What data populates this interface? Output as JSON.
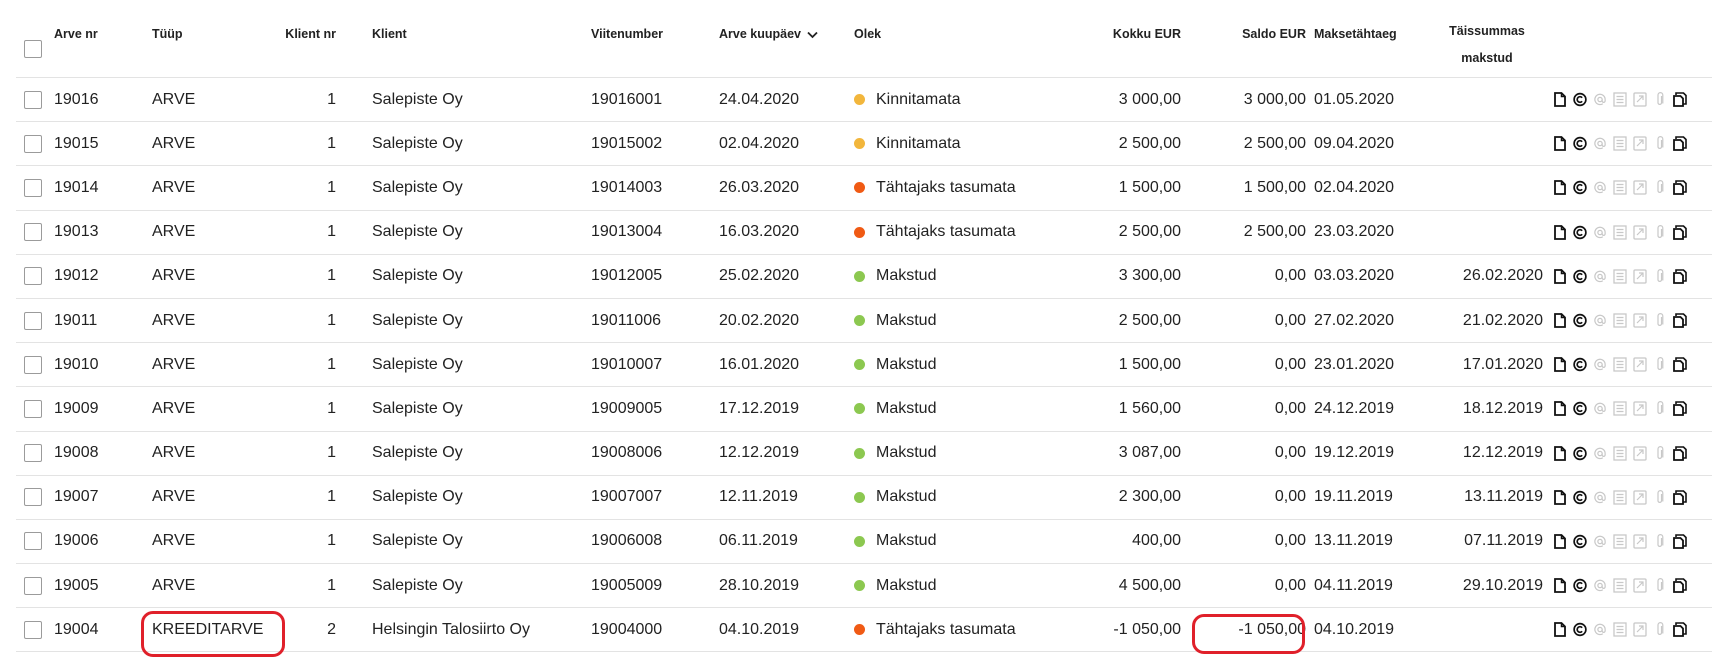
{
  "columns": {
    "arve_nr": "Arve nr",
    "tyyp": "Tüüp",
    "klient_nr": "Klient nr",
    "klient": "Klient",
    "viitenumber": "Viitenumber",
    "arve_kuupaev": "Arve kuupäev",
    "olek": "Olek",
    "kokku": "Kokku EUR",
    "saldo": "Saldo EUR",
    "maksetahtaeg": "Maksetähtaeg",
    "taissummas_1": "Täissummas",
    "taissummas_2": "makstud"
  },
  "status_colors": {
    "Kinnitamata": "#f2b63c",
    "Tähtajaks tasumata": "#f05a14",
    "Makstud": "#8cc850"
  },
  "action_icons": [
    "document-icon",
    "copyright-icon",
    "at-icon",
    "list-icon",
    "receipt-icon",
    "paperclip-icon",
    "copy-icon"
  ],
  "rows": [
    {
      "nr": "19016",
      "type": "ARVE",
      "klnr": "1",
      "klient": "Salepiste Oy",
      "viite": "19016001",
      "date": "24.04.2020",
      "olek": "Kinnitamata",
      "kokku": "3 000,00",
      "saldo": "3 000,00",
      "tahtaeg": "01.05.2020",
      "tais": ""
    },
    {
      "nr": "19015",
      "type": "ARVE",
      "klnr": "1",
      "klient": "Salepiste Oy",
      "viite": "19015002",
      "date": "02.04.2020",
      "olek": "Kinnitamata",
      "kokku": "2 500,00",
      "saldo": "2 500,00",
      "tahtaeg": "09.04.2020",
      "tais": ""
    },
    {
      "nr": "19014",
      "type": "ARVE",
      "klnr": "1",
      "klient": "Salepiste Oy",
      "viite": "19014003",
      "date": "26.03.2020",
      "olek": "Tähtajaks tasumata",
      "kokku": "1 500,00",
      "saldo": "1 500,00",
      "tahtaeg": "02.04.2020",
      "tais": ""
    },
    {
      "nr": "19013",
      "type": "ARVE",
      "klnr": "1",
      "klient": "Salepiste Oy",
      "viite": "19013004",
      "date": "16.03.2020",
      "olek": "Tähtajaks tasumata",
      "kokku": "2 500,00",
      "saldo": "2 500,00",
      "tahtaeg": "23.03.2020",
      "tais": ""
    },
    {
      "nr": "19012",
      "type": "ARVE",
      "klnr": "1",
      "klient": "Salepiste Oy",
      "viite": "19012005",
      "date": "25.02.2020",
      "olek": "Makstud",
      "kokku": "3 300,00",
      "saldo": "0,00",
      "tahtaeg": "03.03.2020",
      "tais": "26.02.2020"
    },
    {
      "nr": "19011",
      "type": "ARVE",
      "klnr": "1",
      "klient": "Salepiste Oy",
      "viite": "19011006",
      "date": "20.02.2020",
      "olek": "Makstud",
      "kokku": "2 500,00",
      "saldo": "0,00",
      "tahtaeg": "27.02.2020",
      "tais": "21.02.2020"
    },
    {
      "nr": "19010",
      "type": "ARVE",
      "klnr": "1",
      "klient": "Salepiste Oy",
      "viite": "19010007",
      "date": "16.01.2020",
      "olek": "Makstud",
      "kokku": "1 500,00",
      "saldo": "0,00",
      "tahtaeg": "23.01.2020",
      "tais": "17.01.2020"
    },
    {
      "nr": "19009",
      "type": "ARVE",
      "klnr": "1",
      "klient": "Salepiste Oy",
      "viite": "19009005",
      "date": "17.12.2019",
      "olek": "Makstud",
      "kokku": "1 560,00",
      "saldo": "0,00",
      "tahtaeg": "24.12.2019",
      "tais": "18.12.2019"
    },
    {
      "nr": "19008",
      "type": "ARVE",
      "klnr": "1",
      "klient": "Salepiste Oy",
      "viite": "19008006",
      "date": "12.12.2019",
      "olek": "Makstud",
      "kokku": "3 087,00",
      "saldo": "0,00",
      "tahtaeg": "19.12.2019",
      "tais": "12.12.2019"
    },
    {
      "nr": "19007",
      "type": "ARVE",
      "klnr": "1",
      "klient": "Salepiste Oy",
      "viite": "19007007",
      "date": "12.11.2019",
      "olek": "Makstud",
      "kokku": "2 300,00",
      "saldo": "0,00",
      "tahtaeg": "19.11.2019",
      "tais": "13.11.2019"
    },
    {
      "nr": "19006",
      "type": "ARVE",
      "klnr": "1",
      "klient": "Salepiste Oy",
      "viite": "19006008",
      "date": "06.11.2019",
      "olek": "Makstud",
      "kokku": "400,00",
      "saldo": "0,00",
      "tahtaeg": "13.11.2019",
      "tais": "07.11.2019"
    },
    {
      "nr": "19005",
      "type": "ARVE",
      "klnr": "1",
      "klient": "Salepiste Oy",
      "viite": "19005009",
      "date": "28.10.2019",
      "olek": "Makstud",
      "kokku": "4 500,00",
      "saldo": "0,00",
      "tahtaeg": "04.11.2019",
      "tais": "29.10.2019"
    },
    {
      "nr": "19004",
      "type": "KREEDITARVE",
      "klnr": "2",
      "klient": "Helsingin Talosiirto Oy",
      "viite": "19004000",
      "date": "04.10.2019",
      "olek": "Tähtajaks tasumata",
      "kokku": "-1 050,00",
      "saldo": "-1 050,00",
      "tahtaeg": "04.10.2019",
      "tais": ""
    }
  ],
  "highlight_color": "#e0202a"
}
